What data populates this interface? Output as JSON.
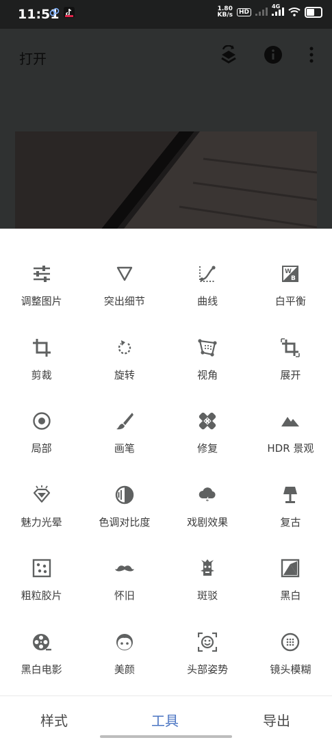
{
  "status_bar": {
    "time": "11:51",
    "net_speed_top": "1.80",
    "net_speed_bottom": "KB/s",
    "hd_badge": "HD",
    "network": "4G",
    "icons": [
      "cloud-sync-icon",
      "tiktok-icon",
      "signal-icon",
      "wifi-icon",
      "battery-icon"
    ]
  },
  "app_bar": {
    "title": "打开",
    "icons": [
      "layers-undo-icon",
      "info-icon",
      "more-vert-icon"
    ]
  },
  "tools": [
    {
      "label": "调整图片",
      "icon": "tune-sliders-icon"
    },
    {
      "label": "突出细节",
      "icon": "triangle-down-icon"
    },
    {
      "label": "曲线",
      "icon": "curve-icon"
    },
    {
      "label": "白平衡",
      "icon": "white-balance-icon"
    },
    {
      "label": "剪裁",
      "icon": "crop-icon"
    },
    {
      "label": "旋转",
      "icon": "rotate-icon"
    },
    {
      "label": "视角",
      "icon": "perspective-icon"
    },
    {
      "label": "展开",
      "icon": "expand-icon"
    },
    {
      "label": "局部",
      "icon": "selective-icon"
    },
    {
      "label": "画笔",
      "icon": "brush-icon"
    },
    {
      "label": "修复",
      "icon": "healing-icon"
    },
    {
      "label": "HDR 景观",
      "icon": "landscape-icon"
    },
    {
      "label": "魅力光晕",
      "icon": "glamour-glow-icon"
    },
    {
      "label": "色调对比度",
      "icon": "tonal-contrast-icon"
    },
    {
      "label": "戏剧效果",
      "icon": "drama-cloud-icon"
    },
    {
      "label": "复古",
      "icon": "vintage-lamp-icon"
    },
    {
      "label": "粗粒胶片",
      "icon": "grainy-film-icon"
    },
    {
      "label": "怀旧",
      "icon": "mustache-icon"
    },
    {
      "label": "斑驳",
      "icon": "grunge-icon"
    },
    {
      "label": "黑白",
      "icon": "black-white-icon"
    },
    {
      "label": "黑白电影",
      "icon": "film-reel-icon"
    },
    {
      "label": "美颜",
      "icon": "face-icon"
    },
    {
      "label": "头部姿势",
      "icon": "head-pose-icon"
    },
    {
      "label": "镜头模糊",
      "icon": "lens-blur-icon"
    }
  ],
  "bottom_nav": {
    "styles": "样式",
    "tools": "工具",
    "export": "导出",
    "active": "tools"
  },
  "colors": {
    "accent": "#4a74c2",
    "icon": "#5f6161",
    "overlay": "#2f3131"
  }
}
